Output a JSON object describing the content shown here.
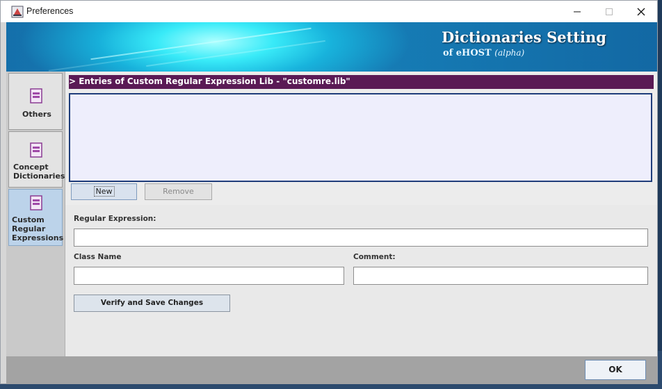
{
  "window": {
    "title": "Preferences",
    "min_glyph": "—",
    "max_glyph": "☐",
    "close_glyph": "✕"
  },
  "banner": {
    "title": "Dictionaries Setting",
    "subtitle": "of eHOST",
    "subtitle_tag": "(alpha)"
  },
  "sidebar": {
    "items": [
      {
        "label": "Others",
        "icon": "document-stack-icon",
        "active": false
      },
      {
        "label": "Concept Dictionaries",
        "icon": "document-stack-icon",
        "active": false
      },
      {
        "label": "Custom Regular Expressions",
        "icon": "document-stack-icon",
        "active": true
      }
    ]
  },
  "main": {
    "section_header": "> Entries of Custom Regular Expression Lib - \"customre.lib\"",
    "new_label": "New",
    "remove_label": "Remove",
    "regex_label": "Regular Expression:",
    "regex_value": "",
    "class_label": "Class Name",
    "class_value": "",
    "comment_label": "Comment:",
    "comment_value": "",
    "verify_label": "Verify and Save Changes"
  },
  "footer": {
    "ok_label": "OK"
  },
  "colors": {
    "header_bg": "#5a1a55",
    "list_border": "#1f3d7a",
    "active_tab": "#bcd3ea"
  }
}
